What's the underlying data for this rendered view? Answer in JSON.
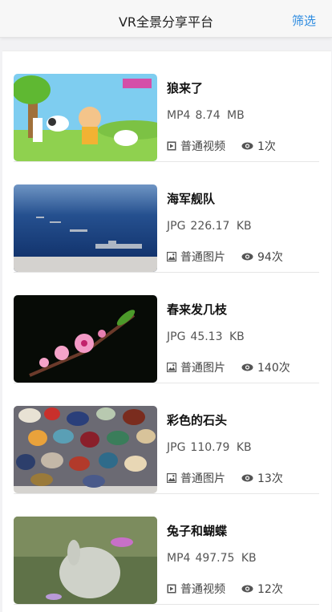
{
  "header": {
    "title": "VR全景分享平台",
    "filter_label": "筛选"
  },
  "items": [
    {
      "name": "狼来了",
      "format": "MP4",
      "size": "8.74 MB",
      "type_label": "普通视频",
      "type_icon": "video-icon",
      "views": "1次"
    },
    {
      "name": "海军舰队",
      "format": "JPG",
      "size": "226.17 KB",
      "type_label": "普通图片",
      "type_icon": "image-icon",
      "views": "94次"
    },
    {
      "name": "春来发几枝",
      "format": "JPG",
      "size": "45.13 KB",
      "type_label": "普通图片",
      "type_icon": "image-icon",
      "views": "140次"
    },
    {
      "name": "彩色的石头",
      "format": "JPG",
      "size": "110.79 KB",
      "type_label": "普通图片",
      "type_icon": "image-icon",
      "views": "13次"
    },
    {
      "name": "兔子和蝴蝶",
      "format": "MP4",
      "size": "497.75 KB",
      "type_label": "普通视频",
      "type_icon": "video-icon",
      "views": "12次"
    }
  ]
}
